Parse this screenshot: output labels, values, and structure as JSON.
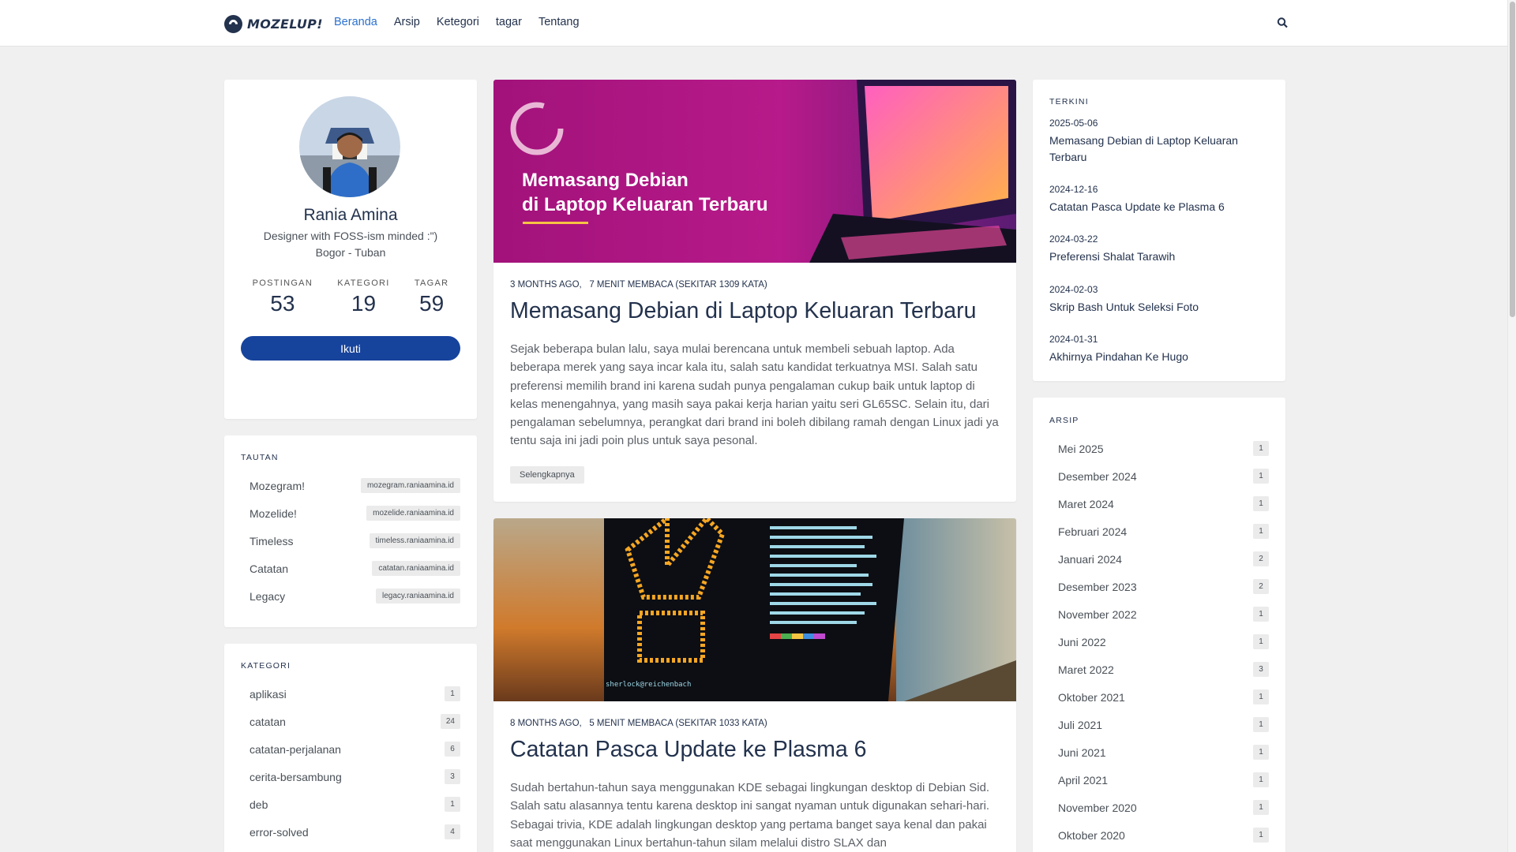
{
  "brand": {
    "name": "MOZELUP!"
  },
  "nav": {
    "items": [
      "Beranda",
      "Arsip",
      "Ketegori",
      "tagar",
      "Tentang"
    ]
  },
  "profile": {
    "name": "Rania Amina",
    "bio": "Designer with FOSS-ism minded :\")",
    "location": " Bogor - Tuban",
    "stats": [
      {
        "label": "POSTINGAN",
        "value": "53"
      },
      {
        "label": "KATEGORI",
        "value": "19"
      },
      {
        "label": "TAGAR",
        "value": "59"
      }
    ],
    "follow_label": "Ikuti",
    "social_icons": [
      "mastodon-icon",
      "github-icon",
      "telegram-icon",
      "email-icon",
      "rss-icon"
    ]
  },
  "links": {
    "title": "TAUTAN",
    "items": [
      {
        "label": "Mozegram!",
        "url": "mozegram.raniaamina.id"
      },
      {
        "label": "Mozelide!",
        "url": "mozelide.raniaamina.id"
      },
      {
        "label": "Timeless",
        "url": "timeless.raniaamina.id"
      },
      {
        "label": "Catatan",
        "url": "catatan.raniaamina.id"
      },
      {
        "label": "Legacy",
        "url": "legacy.raniaamina.id"
      }
    ]
  },
  "categories": {
    "title": "KATEGORI",
    "items": [
      {
        "label": "aplikasi",
        "count": "1"
      },
      {
        "label": "catatan",
        "count": "24"
      },
      {
        "label": "catatan-perjalanan",
        "count": "6"
      },
      {
        "label": "cerita-bersambung",
        "count": "3"
      },
      {
        "label": "deb",
        "count": "1"
      },
      {
        "label": "error-solved",
        "count": "4"
      }
    ]
  },
  "posts": [
    {
      "image_line1": "Memasang Debian",
      "image_line2": "di Laptop Keluaran Terbaru",
      "meta_age": "3 MONTHS AGO,",
      "meta_read": "7 MENIT MEMBACA (SEKITAR 1309 KATA)",
      "title": "Memasang Debian di Laptop Keluaran Terbaru",
      "excerpt": "Sejak beberapa bulan lalu, saya mulai berencana untuk membeli sebuah laptop. Ada beberapa merek yang saya incar kala itu, salah satu kandidat terkuatnya MSI. Salah satu preferensi memilih brand ini karena sudah punya pengalaman cukup baik untuk laptop di kelas menengahnya, yang masih saya pakai kerja harian yaitu seri GL65SC. Selain itu, dari pengalaman sebelumnya, perangkat dari brand ini boleh dibilang ramah dengan Linux jadi ya tentu saja ini jadi poin plus untuk saya pesonal.",
      "read_more": "Selengkapnya"
    },
    {
      "terminal_prompt": "sherlock@reichenbach",
      "meta_age": "8 MONTHS AGO,",
      "meta_read": "5 MENIT MEMBACA (SEKITAR 1033 KATA)",
      "title": "Catatan Pasca Update ke Plasma 6",
      "excerpt": "Sudah bertahun-tahun saya menggunakan KDE sebagai lingkungan desktop di Debian Sid. Salah satu alasannya tentu karena desktop ini sangat nyaman untuk digunakan sehari-hari. Sebagai trivia, KDE adalah lingkungan desktop yang pertama banget saya kenal dan pakai saat menggunakan Linux bertahun-tahun silam melalui distro SLAX dan"
    }
  ],
  "recent": {
    "title": "TERKINI",
    "items": [
      {
        "date": "2025-05-06",
        "title": "Memasang Debian di Laptop Keluaran Terbaru"
      },
      {
        "date": "2024-12-16",
        "title": "Catatan Pasca Update ke Plasma 6"
      },
      {
        "date": "2024-03-22",
        "title": "Preferensi Shalat Tarawih"
      },
      {
        "date": "2024-02-03",
        "title": "Skrip Bash Untuk Seleksi Foto"
      },
      {
        "date": "2024-01-31",
        "title": "Akhirnya Pindahan Ke Hugo"
      }
    ]
  },
  "archive": {
    "title": "ARSIP",
    "items": [
      {
        "label": "Mei 2025",
        "count": "1"
      },
      {
        "label": "Desember 2024",
        "count": "1"
      },
      {
        "label": "Maret 2024",
        "count": "1"
      },
      {
        "label": "Februari 2024",
        "count": "1"
      },
      {
        "label": "Januari 2024",
        "count": "2"
      },
      {
        "label": "Desember 2023",
        "count": "2"
      },
      {
        "label": "November 2022",
        "count": "1"
      },
      {
        "label": "Juni 2022",
        "count": "1"
      },
      {
        "label": "Maret 2022",
        "count": "3"
      },
      {
        "label": "Oktober 2021",
        "count": "1"
      },
      {
        "label": "Juli 2021",
        "count": "1"
      },
      {
        "label": "Juni 2021",
        "count": "1"
      },
      {
        "label": "April 2021",
        "count": "1"
      },
      {
        "label": "November 2020",
        "count": "1"
      },
      {
        "label": "Oktober 2020",
        "count": "1"
      }
    ]
  }
}
